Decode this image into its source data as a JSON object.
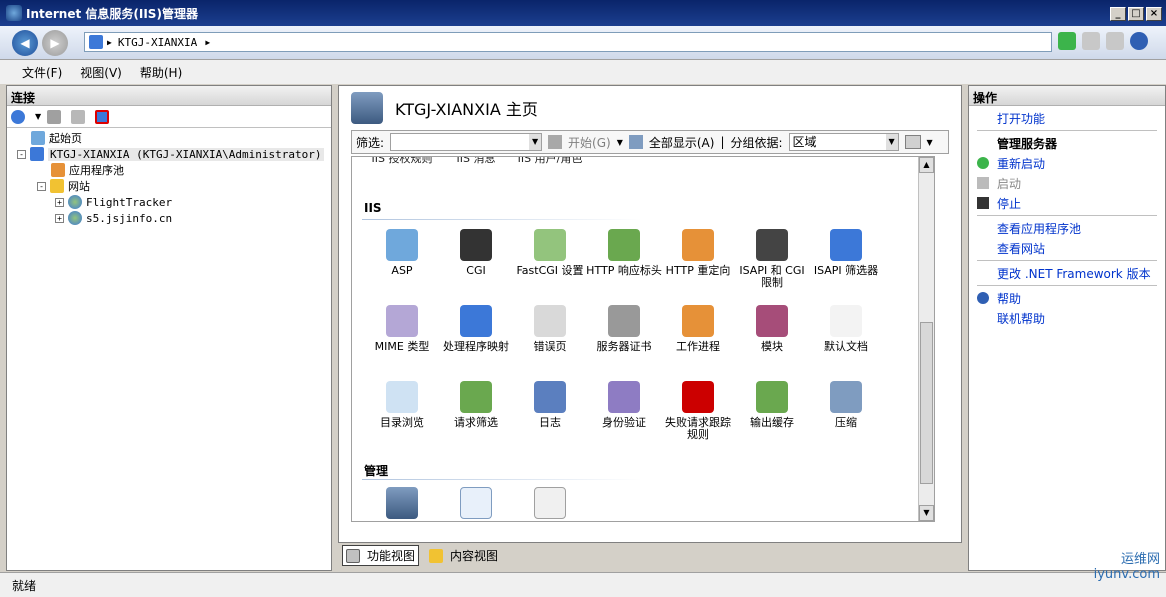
{
  "window": {
    "title": "Internet 信息服务(IIS)管理器"
  },
  "address": {
    "path": [
      "KTGJ-XIANXIA"
    ]
  },
  "menu": [
    {
      "label": "文件(F)"
    },
    {
      "label": "视图(V)"
    },
    {
      "label": "帮助(H)"
    }
  ],
  "connections": {
    "title": "连接",
    "tree": [
      {
        "label": "起始页",
        "level": 1,
        "expander": ""
      },
      {
        "label": "KTGJ-XIANXIA (KTGJ-XIANXIA\\Administrator)",
        "level": 0,
        "expander": "-"
      },
      {
        "label": "应用程序池",
        "level": 2,
        "expander": ""
      },
      {
        "label": "网站",
        "level": 1,
        "expander": "-"
      },
      {
        "label": "FlightTracker",
        "level": 2,
        "expander": "+"
      },
      {
        "label": "s5.jsjinfo.cn",
        "level": 2,
        "expander": "+"
      }
    ]
  },
  "center": {
    "title": "KTGJ-XIANXIA 主页",
    "filter": {
      "label": "筛选:",
      "start": "开始(G)",
      "showall": "全部显示(A)",
      "groupby_label": "分组依据:",
      "groupby_value": "区域"
    },
    "partial_labels": [
      "IIS 授权规则",
      "IIS 消息",
      "IIS 用户/角色"
    ],
    "sections": [
      {
        "title": "IIS",
        "features": [
          "ASP",
          "CGI",
          "FastCGI 设置",
          "HTTP 响应标头",
          "HTTP 重定向",
          "ISAPI 和 CGI 限制",
          "ISAPI 筛选器",
          "MIME 类型",
          "处理程序映射",
          "错误页",
          "服务器证书",
          "工作进程",
          "模块",
          "默认文档",
          "目录浏览",
          "请求筛选",
          "日志",
          "身份验证",
          "失败请求跟踪规则",
          "输出缓存",
          "压缩"
        ]
      },
      {
        "title": "管理",
        "features": [
          "",
          "",
          ""
        ]
      }
    ]
  },
  "views": {
    "feature": "功能视图",
    "content": "内容视图"
  },
  "actions": {
    "title": "操作",
    "items": [
      {
        "label": "打开功能",
        "type": "link"
      },
      {
        "type": "sep"
      },
      {
        "label": "管理服务器",
        "type": "group"
      },
      {
        "label": "重新启动",
        "type": "link",
        "icon": "restart-icon"
      },
      {
        "label": "启动",
        "type": "disabled",
        "icon": "start-icon"
      },
      {
        "label": "停止",
        "type": "link",
        "icon": "stop-icon"
      },
      {
        "type": "sep"
      },
      {
        "label": "查看应用程序池",
        "type": "link"
      },
      {
        "label": "查看网站",
        "type": "link"
      },
      {
        "type": "sep"
      },
      {
        "label": "更改 .NET Framework 版本",
        "type": "link"
      },
      {
        "type": "sep"
      },
      {
        "label": "帮助",
        "type": "link",
        "icon": "help-icon"
      },
      {
        "label": "联机帮助",
        "type": "link"
      }
    ]
  },
  "status": "就绪",
  "watermark": {
    "brand": "运维网",
    "site": "iyunv.com"
  }
}
